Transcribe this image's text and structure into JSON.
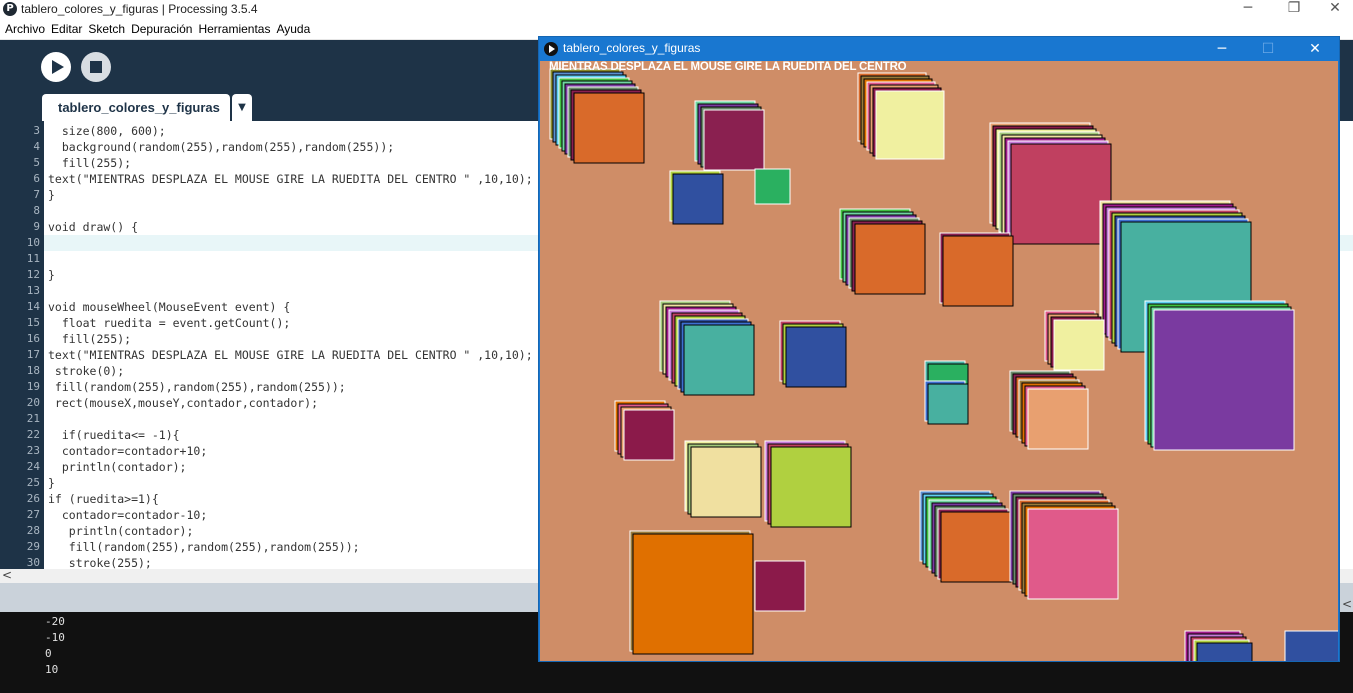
{
  "window": {
    "title": "tablero_colores_y_figuras | Processing 3.5.4",
    "app_icon": "processing-logo-icon",
    "app_icon_glyph": "P",
    "minimize": "─",
    "maximize": "❐",
    "close": "✕"
  },
  "menu": [
    "Archivo",
    "Editar",
    "Sketch",
    "Depuración",
    "Herramientas",
    "Ayuda"
  ],
  "toolbar": {
    "run_icon": "play-icon",
    "stop_icon": "stop-icon"
  },
  "tabs": [
    {
      "label": "tablero_colores_y_figuras",
      "dropdown": "▼"
    }
  ],
  "editor": {
    "active_line": 10,
    "lines": [
      {
        "num": "3",
        "text": "  size(800, 600);"
      },
      {
        "num": "4",
        "text": "  background(random(255),random(255),random(255));"
      },
      {
        "num": "5",
        "text": "  fill(255);"
      },
      {
        "num": "6",
        "text": "text(\"MIENTRAS DESPLAZA EL MOUSE GIRE LA RUEDITA DEL CENTRO \" ,10,10);"
      },
      {
        "num": "7",
        "text": "}"
      },
      {
        "num": "8",
        "text": ""
      },
      {
        "num": "9",
        "text": "void draw() {"
      },
      {
        "num": "10",
        "text": ""
      },
      {
        "num": "11",
        "text": ""
      },
      {
        "num": "12",
        "text": "}"
      },
      {
        "num": "13",
        "text": ""
      },
      {
        "num": "14",
        "text": "void mouseWheel(MouseEvent event) {"
      },
      {
        "num": "15",
        "text": "  float ruedita = event.getCount();"
      },
      {
        "num": "16",
        "text": "  fill(255);"
      },
      {
        "num": "17",
        "text": "text(\"MIENTRAS DESPLAZA EL MOUSE GIRE LA RUEDITA DEL CENTRO \" ,10,10);"
      },
      {
        "num": "18",
        "text": " stroke(0);"
      },
      {
        "num": "19",
        "text": " fill(random(255),random(255),random(255));"
      },
      {
        "num": "20",
        "text": " rect(mouseX,mouseY,contador,contador);"
      },
      {
        "num": "21",
        "text": ""
      },
      {
        "num": "22",
        "text": "  if(ruedita<= -1){"
      },
      {
        "num": "23",
        "text": "  contador=contador+10;"
      },
      {
        "num": "24",
        "text": "  println(contador);"
      },
      {
        "num": "25",
        "text": "}"
      },
      {
        "num": "26",
        "text": "if (ruedita>=1){"
      },
      {
        "num": "27",
        "text": "  contador=contador-10;"
      },
      {
        "num": "28",
        "text": "   println(contador);"
      },
      {
        "num": "29",
        "text": "   fill(random(255),random(255),random(255));"
      },
      {
        "num": "30",
        "text": "   stroke(255);"
      }
    ]
  },
  "scrollbar": {
    "left_arrow": "<",
    "right_arrow": "<"
  },
  "console": [
    "-20",
    "-10",
    "0",
    "10"
  ],
  "sketch": {
    "title": "tablero_colores_y_figuras",
    "minimize": "─",
    "maximize": "☐",
    "close": "✕",
    "canvas_text": "MIENTRAS DESPLAZA EL MOUSE GIRE LA RUEDITA DEL CENTRO",
    "background": "#cf8d67"
  },
  "colors": {
    "ide_dark": "#1e3347",
    "sketch_titlebar": "#1977d0",
    "console_bg": "#111111"
  }
}
